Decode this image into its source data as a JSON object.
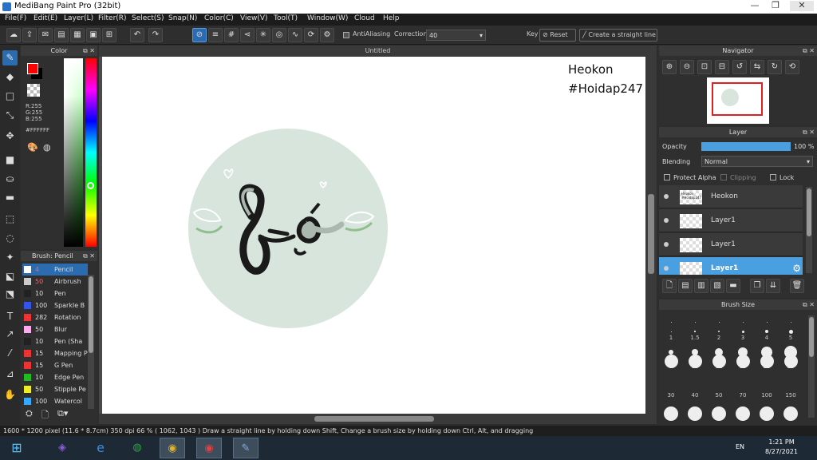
{
  "window": {
    "title": "MediBang Paint Pro (32bit)",
    "minimize": "—",
    "maximize": "❐",
    "close": "✕"
  },
  "menu": [
    "File(F)",
    "Edit(E)",
    "Layer(L)",
    "Filter(R)",
    "Select(S)",
    "Snap(N)",
    "Color(C)",
    "View(V)",
    "Tool(T)",
    "Window(W)",
    "Cloud",
    "Help"
  ],
  "toolbar": {
    "antialiasing_label": "AntiAliasing",
    "correction_label": "Correction",
    "correction_value": "40",
    "key_label": "Key",
    "reset_label": "Reset",
    "straight_line_label": "Create a straight line"
  },
  "color_panel": {
    "title": "Color",
    "r": "R:255",
    "g": "G:255",
    "b": "B:255",
    "hex": "#FFFFFF",
    "fg_color": "#ff0000",
    "bg_color": "#ffffff"
  },
  "brush_panel": {
    "title": "Brush: Pencil",
    "brushes": [
      {
        "size": "4",
        "name": "Pencil",
        "color": "#ffffff"
      },
      {
        "size": "50",
        "name": "Airbrush",
        "color": "#cccccc"
      },
      {
        "size": "10",
        "name": "Pen",
        "color": "#222222"
      },
      {
        "size": "100",
        "name": "Sparkle B",
        "color": "#3355ee"
      },
      {
        "size": "282",
        "name": "Rotation",
        "color": "#ee3333"
      },
      {
        "size": "50",
        "name": "Blur",
        "color": "#ffaaee"
      },
      {
        "size": "10",
        "name": "Pen (Sha",
        "color": "#222222"
      },
      {
        "size": "15",
        "name": "Mapping P",
        "color": "#ee3333"
      },
      {
        "size": "15",
        "name": "G Pen",
        "color": "#ee3333"
      },
      {
        "size": "10",
        "name": "Edge Pen",
        "color": "#22bb22"
      },
      {
        "size": "50",
        "name": "Stipple Pe",
        "color": "#eeee22"
      },
      {
        "size": "100",
        "name": "Watercol",
        "color": "#33aaff"
      }
    ]
  },
  "document": {
    "tab_title": "Untitled",
    "canvas_text_line1": "Heokon",
    "canvas_text_line2": "#Hoidap247",
    "circle_color": "#d8e5dc"
  },
  "navigator": {
    "title": "Navigator"
  },
  "layer_panel": {
    "title": "Layer",
    "opacity_label": "Opacity",
    "opacity_value": "100 %",
    "opacity_fraction": 1.0,
    "blending_label": "Blending",
    "blending_value": "Normal",
    "protect_alpha": "Protect Alpha",
    "clipping": "Clipping",
    "lock": "Lock",
    "layers": [
      {
        "name": "Heokon",
        "thumb_text": "Heokon #Hoidap247",
        "selected": false
      },
      {
        "name": "Layer1",
        "selected": false
      },
      {
        "name": "Layer1",
        "selected": false
      },
      {
        "name": "Layer1",
        "selected": true
      }
    ]
  },
  "brush_size_panel": {
    "title": "Brush Size",
    "rows": [
      [
        "1",
        "1.5",
        "2",
        "3",
        "4",
        "5"
      ],
      [
        "7",
        "10",
        "12",
        "15",
        "20",
        "25"
      ],
      [
        "30",
        "40",
        "50",
        "70",
        "100",
        "150"
      ]
    ]
  },
  "status": {
    "text": "1600 * 1200 pixel   (11.6 * 8.7cm)   350 dpi   66 %   ( 1062, 1043 )   Draw a straight line by holding down Shift, Change a brush size by holding down Ctrl, Alt, and dragging"
  },
  "taskbar": {
    "lang": "EN",
    "time": "1:21 PM",
    "date": "8/27/2021"
  }
}
